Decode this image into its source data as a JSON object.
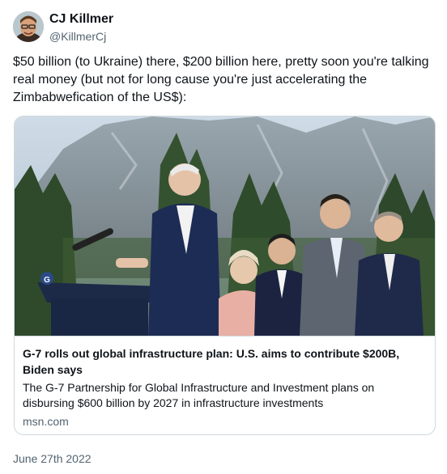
{
  "author": {
    "name": "CJ Killmer",
    "handle": "@KillmerCj"
  },
  "tweet": {
    "text": "$50 billion (to Ukraine) there, $200 billion here, pretty soon you're talking real money (but not for long cause you're just accelerating the Zimbabwefication of the US$):",
    "date": "June 27th 2022"
  },
  "card": {
    "title": "G-7 rolls out global infrastructure plan: U.S. aims to contribute $200B, Biden says",
    "description": "The G-7 Partnership for Global Infrastructure and Investment plans on disbursing $600 billion by 2027 in infrastructure investments",
    "domain": "msn.com",
    "podium_logo": "G"
  },
  "colors": {
    "text": "#0f1419",
    "secondary": "#536471",
    "border": "#cfd9de"
  }
}
